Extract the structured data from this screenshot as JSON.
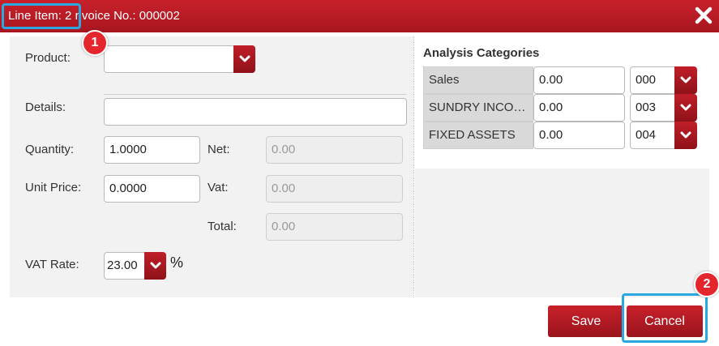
{
  "titlebar": {
    "line_item": "Line Item: 2",
    "invoice": "nvoice No.: 000002",
    "close_icon": "close-icon"
  },
  "form": {
    "product_label": "Product:",
    "product_value": "",
    "details_label": "Details:",
    "details_value": "",
    "quantity_label": "Quantity:",
    "quantity_value": "1.0000",
    "net_label": "Net:",
    "net_value": "0.00",
    "unit_price_label": "Unit Price:",
    "unit_price_value": "0.0000",
    "vat_label": "Vat:",
    "vat_value": "0.00",
    "total_label": "Total:",
    "total_value": "0.00",
    "vat_rate_label": "VAT Rate:",
    "vat_rate_value": "23.00",
    "vat_rate_unit": "%"
  },
  "analysis": {
    "title": "Analysis Categories",
    "rows": [
      {
        "name": "Sales",
        "amount": "0.00",
        "code": "000"
      },
      {
        "name": "SUNDRY INCOME",
        "amount": "0.00",
        "code": "003"
      },
      {
        "name": "FIXED ASSETS",
        "amount": "0.00",
        "code": "004"
      }
    ]
  },
  "buttons": {
    "save": "Save",
    "cancel": "Cancel"
  },
  "annotations": {
    "badge1": "1",
    "badge2": "2"
  },
  "colors": {
    "brand_red": "#b81a23",
    "callout_blue": "#2aa8e0",
    "badge_red": "#e4262c"
  }
}
